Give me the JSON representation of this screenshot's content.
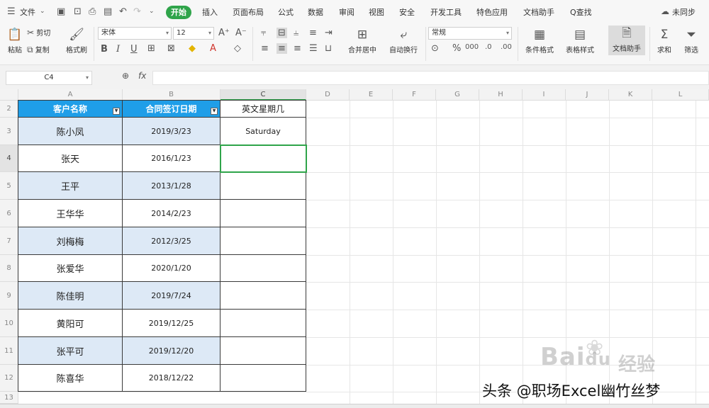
{
  "menubar": {
    "file_label": "文件",
    "active_tab": "开始",
    "tabs": [
      "插入",
      "页面布局",
      "公式",
      "数据",
      "审阅",
      "视图",
      "安全",
      "开发工具",
      "特色应用",
      "文档助手"
    ],
    "search_label": "Q查找",
    "sync_label": "未同步"
  },
  "ribbon": {
    "paste": "粘贴",
    "cut": "剪切",
    "copy": "复制",
    "format_painter": "格式刷",
    "font_name": "宋体",
    "font_size": "12",
    "merge_center": "合并居中",
    "wrap_text": "自动换行",
    "number_format": "常规",
    "conditional_format": "条件格式",
    "table_style": "表格样式",
    "doc_helper": "文档助手",
    "sum": "求和",
    "filter": "筛选"
  },
  "formula_bar": {
    "cell_ref": "C4",
    "fx": "fx",
    "value": ""
  },
  "columns": [
    "A",
    "B",
    "C",
    "D",
    "E",
    "F",
    "G",
    "H",
    "I",
    "J",
    "K",
    "L"
  ],
  "rows": [
    "2",
    "3",
    "4",
    "5",
    "6",
    "7",
    "8",
    "9",
    "10",
    "11",
    "12",
    "13"
  ],
  "table": {
    "headers": [
      "客户名称",
      "合同签订日期",
      "英文星期几"
    ],
    "data": [
      {
        "name": "陈小凤",
        "date": "2019/3/23",
        "weekday": "Saturday"
      },
      {
        "name": "张天",
        "date": "2016/1/23",
        "weekday": ""
      },
      {
        "name": "王平",
        "date": "2013/1/28",
        "weekday": ""
      },
      {
        "name": "王华华",
        "date": "2014/2/23",
        "weekday": ""
      },
      {
        "name": "刘梅梅",
        "date": "2012/3/25",
        "weekday": ""
      },
      {
        "name": "张爱华",
        "date": "2020/1/20",
        "weekday": ""
      },
      {
        "name": "陈佳明",
        "date": "2019/7/24",
        "weekday": ""
      },
      {
        "name": "黄阳可",
        "date": "2019/12/25",
        "weekday": ""
      },
      {
        "name": "张平可",
        "date": "2019/12/20",
        "weekday": ""
      },
      {
        "name": "陈喜华",
        "date": "2018/12/22",
        "weekday": ""
      }
    ]
  },
  "watermark": {
    "baidu": "Bai",
    "baidu_du": "du",
    "jingyan": "经验",
    "toutiao": "头条 @职场Excel幽竹丝梦"
  }
}
